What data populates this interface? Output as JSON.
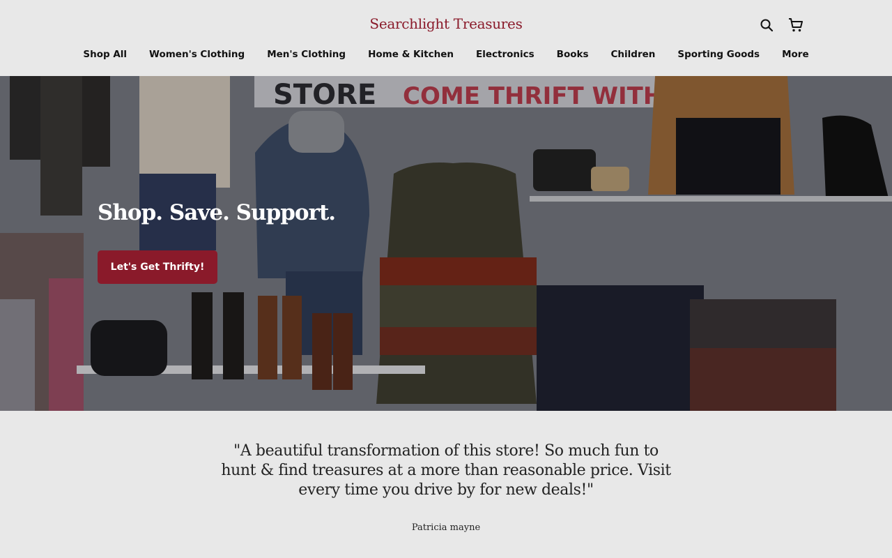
{
  "header": {
    "logo": "Searchlight Treasures",
    "icons": [
      "search-icon",
      "cart-icon"
    ]
  },
  "nav": {
    "items": [
      "Shop All",
      "Women's Clothing",
      "Men's Clothing",
      "Home & Kitchen",
      "Electronics",
      "Books",
      "Children",
      "Sporting Goods",
      "More"
    ]
  },
  "hero": {
    "title": "Shop. Save. Support.",
    "button_label": "Let's Get Thrifty!",
    "sign_text_left": "STORE",
    "sign_text_right": "COME THRIFT WITH U"
  },
  "testimonial": {
    "quote": "\"A beautiful transformation of this store! So much fun to hunt & find treasures at a more than reasonable price. Visit every time you drive by for new deals!\"",
    "author": "Patricia mayne"
  },
  "colors": {
    "brand": "#8a1a2a",
    "background": "#e8e8e8"
  }
}
